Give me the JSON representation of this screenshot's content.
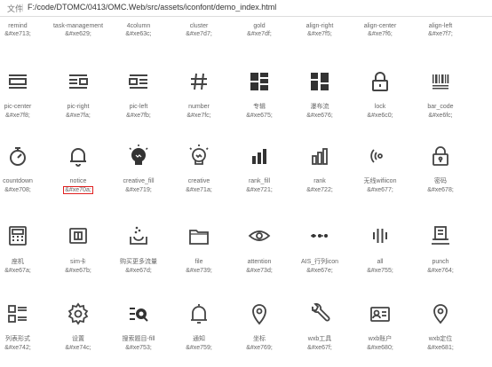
{
  "address_bar": {
    "label": "文件",
    "separator": "|",
    "path": "F:/code/DTOMC/0413/OMC.Web/src/assets/iconfont/demo_index.html"
  },
  "highlight_color": "#e02020",
  "rows": [
    [
      {
        "name": "remind",
        "code": "&#xe713;",
        "icon": "none"
      },
      {
        "name": "task-management",
        "code": "&#xe629;",
        "icon": "none"
      },
      {
        "name": "4column",
        "code": "&#xe63c;",
        "icon": "none"
      },
      {
        "name": "cluster",
        "code": "&#xe7d7;",
        "icon": "none"
      },
      {
        "name": "gold",
        "code": "&#xe7df;",
        "icon": "none"
      },
      {
        "name": "align-right",
        "code": "&#xe7f5;",
        "icon": "none"
      },
      {
        "name": "align-center",
        "code": "&#xe7f6;",
        "icon": "none"
      },
      {
        "name": "align-left",
        "code": "&#xe7f7;",
        "icon": "none"
      }
    ],
    [
      {
        "name": "pic-center",
        "code": "&#xe7f8;",
        "icon": "pic-center-icon"
      },
      {
        "name": "pic-right",
        "code": "&#xe7fa;",
        "icon": "pic-right-icon"
      },
      {
        "name": "pic-left",
        "code": "&#xe7fb;",
        "icon": "pic-left-icon"
      },
      {
        "name": "number",
        "code": "&#xe7fc;",
        "icon": "hash-icon"
      },
      {
        "name": "专辑",
        "code": "&#xe675;",
        "icon": "album-icon"
      },
      {
        "name": "瀑布流",
        "code": "&#xe676;",
        "icon": "waterfall-icon"
      },
      {
        "name": "lock",
        "code": "&#xe6c0;",
        "icon": "lock-icon"
      },
      {
        "name": "bar_code",
        "code": "&#xe6fc;",
        "icon": "barcode-icon"
      }
    ],
    [
      {
        "name": "countdown",
        "code": "&#xe708;",
        "icon": "stopwatch-icon"
      },
      {
        "name": "notice",
        "code": "&#xe70a;",
        "icon": "bell-icon",
        "highlight": true
      },
      {
        "name": "creative_fill",
        "code": "&#xe719;",
        "icon": "bulb-fill-icon"
      },
      {
        "name": "creative",
        "code": "&#xe71a;",
        "icon": "bulb-icon"
      },
      {
        "name": "rank_fill",
        "code": "&#xe721;",
        "icon": "rank-fill-icon"
      },
      {
        "name": "rank",
        "code": "&#xe722;",
        "icon": "rank-icon"
      },
      {
        "name": "无线wifiicon",
        "code": "&#xe677;",
        "icon": "wifi-icon"
      },
      {
        "name": "密码",
        "code": "&#xe678;",
        "icon": "password-lock-icon"
      }
    ],
    [
      {
        "name": "座机",
        "code": "&#xe67a;",
        "icon": "landline-icon"
      },
      {
        "name": "sim卡",
        "code": "&#xe67b;",
        "icon": "sim-card-icon"
      },
      {
        "name": "购买更多流量",
        "code": "&#xe67d;",
        "icon": "buy-traffic-icon"
      },
      {
        "name": "file",
        "code": "&#xe739;",
        "icon": "folder-icon"
      },
      {
        "name": "attention",
        "code": "&#xe73d;",
        "icon": "eye-icon"
      },
      {
        "name": "AIS_行列icon",
        "code": "&#xe67e;",
        "icon": "row-col-icon"
      },
      {
        "name": "all",
        "code": "&#xe755;",
        "icon": "all-bars-icon"
      },
      {
        "name": "punch",
        "code": "&#xe764;",
        "icon": "punch-icon"
      }
    ],
    [
      {
        "name": "列表形式",
        "code": "&#xe742;",
        "icon": "list-form-icon"
      },
      {
        "name": "设置",
        "code": "&#xe74c;",
        "icon": "gear-icon"
      },
      {
        "name": "搜索题目-fill",
        "code": "&#xe753;",
        "icon": "search-list-icon"
      },
      {
        "name": "通知",
        "code": "&#xe759;",
        "icon": "notify-bell-icon"
      },
      {
        "name": "坐标",
        "code": "&#xe769;",
        "icon": "location-pin-icon"
      },
      {
        "name": "wxb工具",
        "code": "&#xe67f;",
        "icon": "wrench-icon"
      },
      {
        "name": "wxb账户",
        "code": "&#xe680;",
        "icon": "account-card-icon"
      },
      {
        "name": "wxb定位",
        "code": "&#xe681;",
        "icon": "location-icon"
      }
    ]
  ]
}
